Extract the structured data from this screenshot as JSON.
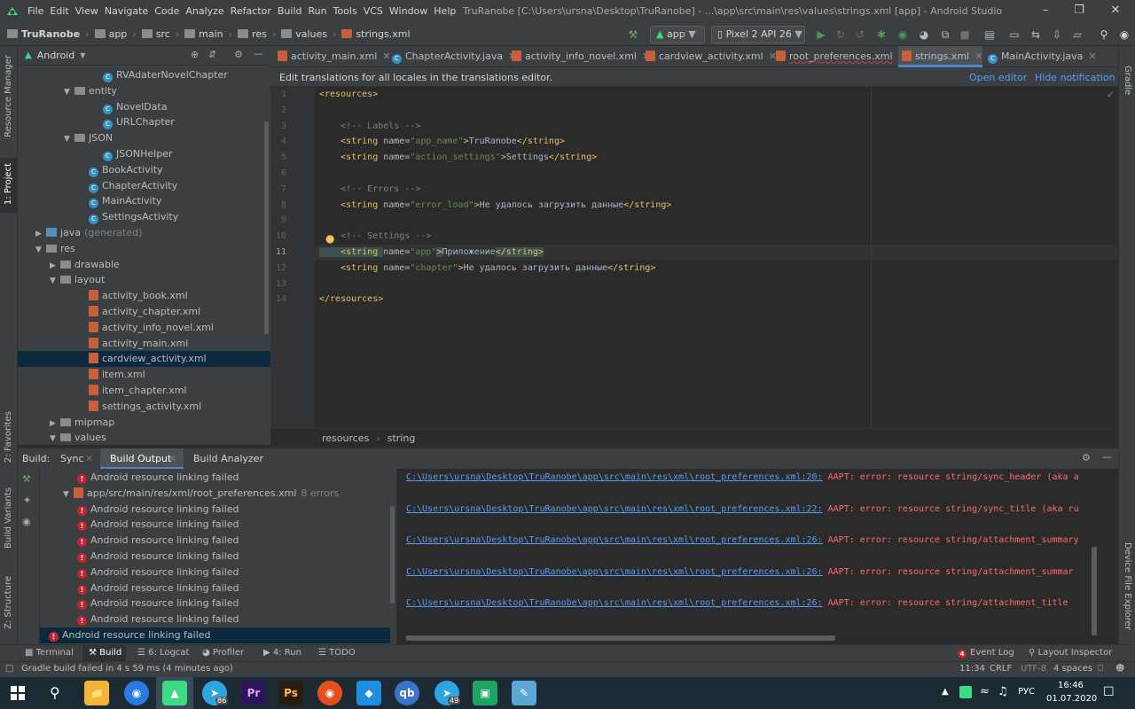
{
  "window": {
    "menu": [
      "File",
      "Edit",
      "View",
      "Navigate",
      "Code",
      "Analyze",
      "Refactor",
      "Build",
      "Run",
      "Tools",
      "VCS",
      "Window",
      "Help"
    ],
    "title": "TruRanobe [C:\\Users\\ursna\\Desktop\\TruRanobe] - ...\\app\\src\\main\\res\\values\\strings.xml [app] - Android Studio"
  },
  "breadcrumb": [
    "TruRanobe",
    "app",
    "src",
    "main",
    "res",
    "values",
    "strings.xml"
  ],
  "toolbar": {
    "config": "app",
    "device": "Pixel 2 API 26"
  },
  "left_strip": {
    "resource_manager": "Resource Manager",
    "project": "1: Project",
    "favorites": "2: Favorites",
    "build_variants": "Build Variants",
    "structure": "Z: Structure"
  },
  "right_strip": {
    "gradle": "Gradle",
    "device_file_explorer": "Device File Explorer"
  },
  "project": {
    "view_mode": "Android",
    "tree": [
      {
        "label": "RVAdaterNovelChapter",
        "icon": "class",
        "indent": 5
      },
      {
        "label": "entity",
        "icon": "folder",
        "indent": 3,
        "arrow": "▼"
      },
      {
        "label": "NovelData",
        "icon": "class",
        "indent": 5
      },
      {
        "label": "URLChapter",
        "icon": "class",
        "indent": 5
      },
      {
        "label": "JSON",
        "icon": "folder",
        "indent": 3,
        "arrow": "▼"
      },
      {
        "label": "JSONHelper",
        "icon": "class",
        "indent": 5
      },
      {
        "label": "BookActivity",
        "icon": "class",
        "indent": 4
      },
      {
        "label": "ChapterActivity",
        "icon": "class",
        "indent": 4
      },
      {
        "label": "MainActivity",
        "icon": "class",
        "indent": 4
      },
      {
        "label": "SettingsActivity",
        "icon": "class",
        "indent": 4
      },
      {
        "label": "java",
        "suffix": "(generated)",
        "icon": "java",
        "indent": 1,
        "arrow": "▶"
      },
      {
        "label": "res",
        "icon": "folder",
        "indent": 1,
        "arrow": "▼"
      },
      {
        "label": "drawable",
        "icon": "folder",
        "indent": 2,
        "arrow": "▶"
      },
      {
        "label": "layout",
        "icon": "folder",
        "indent": 2,
        "arrow": "▼"
      },
      {
        "label": "activity_book.xml",
        "icon": "xml",
        "indent": 4
      },
      {
        "label": "activity_chapter.xml",
        "icon": "xml",
        "indent": 4
      },
      {
        "label": "activity_info_novel.xml",
        "icon": "xml",
        "indent": 4
      },
      {
        "label": "activity_main.xml",
        "icon": "xml",
        "indent": 4
      },
      {
        "label": "cardview_activity.xml",
        "icon": "xml",
        "indent": 4,
        "selected": true
      },
      {
        "label": "item.xml",
        "icon": "xml",
        "indent": 4
      },
      {
        "label": "item_chapter.xml",
        "icon": "xml",
        "indent": 4
      },
      {
        "label": "settings_activity.xml",
        "icon": "xml",
        "indent": 4
      },
      {
        "label": "mipmap",
        "icon": "folder",
        "indent": 2,
        "arrow": "▶"
      },
      {
        "label": "values",
        "icon": "folder",
        "indent": 2,
        "arrow": "▼"
      }
    ]
  },
  "tabs": [
    {
      "label": "activity_main.xml",
      "icon": "xml"
    },
    {
      "label": "ChapterActivity.java",
      "icon": "class"
    },
    {
      "label": "activity_info_novel.xml",
      "icon": "xml"
    },
    {
      "label": "cardview_activity.xml",
      "icon": "xml"
    },
    {
      "label": "root_preferences.xml",
      "icon": "xml"
    },
    {
      "label": "strings.xml",
      "icon": "xml",
      "active": true
    },
    {
      "label": "MainActivity.java",
      "icon": "class"
    }
  ],
  "notice": {
    "text": "Edit translations for all locales in the translations editor.",
    "open_editor": "Open editor",
    "hide": "Hide notification"
  },
  "editor": {
    "line_numbers": [
      "1",
      "2",
      "3",
      "4",
      "5",
      "6",
      "7",
      "8",
      "9",
      "10",
      "11",
      "12",
      "13",
      "14"
    ],
    "lines": [
      [
        {
          "t": "<resources>",
          "c": "tg"
        }
      ],
      [],
      [
        {
          "t": "    <!-- Labels -->",
          "c": "cm"
        }
      ],
      [
        {
          "t": "    <string ",
          "c": "tg"
        },
        {
          "t": "name=",
          "c": "at"
        },
        {
          "t": "\"app_name\"",
          "c": "av"
        },
        {
          "t": ">",
          "c": "tg"
        },
        {
          "t": "TruRanobe",
          "c": "tx"
        },
        {
          "t": "</string>",
          "c": "tg"
        }
      ],
      [
        {
          "t": "    <string ",
          "c": "tg"
        },
        {
          "t": "name=",
          "c": "at"
        },
        {
          "t": "\"action_settings\"",
          "c": "av"
        },
        {
          "t": ">",
          "c": "tg"
        },
        {
          "t": "Settings",
          "c": "tx"
        },
        {
          "t": "</string>",
          "c": "tg"
        }
      ],
      [],
      [
        {
          "t": "    <!-- Errors -->",
          "c": "cm"
        }
      ],
      [
        {
          "t": "    <string ",
          "c": "tg"
        },
        {
          "t": "name=",
          "c": "at"
        },
        {
          "t": "\"error_load\"",
          "c": "av"
        },
        {
          "t": ">",
          "c": "tg"
        },
        {
          "t": "Не удалось загрузить данные",
          "c": "tx"
        },
        {
          "t": "</string>",
          "c": "tg"
        }
      ],
      [],
      [
        {
          "t": "    <!-- Settings -->",
          "c": "cm"
        }
      ],
      [
        {
          "t": "    <string ",
          "c": "tg"
        },
        {
          "t": "name=",
          "c": "at"
        },
        {
          "t": "\"app\"",
          "c": "av"
        },
        {
          "t": ">",
          "c": "tg"
        },
        {
          "t": "Приложение",
          "c": "tx"
        },
        {
          "t": "</string>",
          "c": "tg"
        }
      ],
      [
        {
          "t": "    <string ",
          "c": "tg"
        },
        {
          "t": "name=",
          "c": "at"
        },
        {
          "t": "\"chapter\"",
          "c": "av"
        },
        {
          "t": ">",
          "c": "tg"
        },
        {
          "t": "Не удалось загрузить данные",
          "c": "tx"
        },
        {
          "t": "</string>",
          "c": "tg"
        }
      ],
      [],
      [
        {
          "t": "</resources>",
          "c": "tg"
        }
      ]
    ],
    "crumb": [
      "resources",
      "string"
    ]
  },
  "build": {
    "tabs": [
      "Build:",
      "Sync",
      "Build Output",
      "Build Analyzer"
    ],
    "tree": [
      {
        "label": "Android resource linking failed",
        "type": "error",
        "indent": 2
      },
      {
        "label": "app/src/main/res/xml/root_preferences.xml",
        "suffix": "8 errors",
        "type": "file",
        "indent": 1
      },
      {
        "label": "Android resource linking failed",
        "type": "error",
        "indent": 2
      },
      {
        "label": "Android resource linking failed",
        "type": "error",
        "indent": 2
      },
      {
        "label": "Android resource linking failed",
        "type": "error",
        "indent": 2
      },
      {
        "label": "Android resource linking failed",
        "type": "error",
        "indent": 2
      },
      {
        "label": "Android resource linking failed",
        "type": "error",
        "indent": 2
      },
      {
        "label": "Android resource linking failed",
        "type": "error",
        "indent": 2
      },
      {
        "label": "Android resource linking failed",
        "type": "error",
        "indent": 2
      },
      {
        "label": "Android resource linking failed",
        "type": "error",
        "indent": 2
      },
      {
        "label": "Android resource linking failed",
        "type": "error",
        "indent": 0,
        "selected": true
      }
    ],
    "output": [
      {
        "link": "C:\\Users\\ursna\\Desktop\\TruRanobe\\app\\src\\main\\res\\xml\\root_preferences.xml:20:",
        "msg": " AAPT: error: resource string/sync_header (aka a"
      },
      {
        "link": "C:\\Users\\ursna\\Desktop\\TruRanobe\\app\\src\\main\\res\\xml\\root_preferences.xml:22:",
        "msg": " AAPT: error: resource string/sync_title (aka ru"
      },
      {
        "link": "C:\\Users\\ursna\\Desktop\\TruRanobe\\app\\src\\main\\res\\xml\\root_preferences.xml:26:",
        "msg": " AAPT: error: resource string/attachment_summary"
      },
      {
        "link": "C:\\Users\\ursna\\Desktop\\TruRanobe\\app\\src\\main\\res\\xml\\root_preferences.xml:26:",
        "msg": " AAPT: error: resource string/attachment_summar"
      },
      {
        "link": "C:\\Users\\ursna\\Desktop\\TruRanobe\\app\\src\\main\\res\\xml\\root_preferences.xml:26:",
        "msg": " AAPT: error: resource string/attachment_title"
      }
    ]
  },
  "toolwindows": {
    "terminal": "Terminal",
    "build": "Build",
    "logcat": "6: Logcat",
    "profiler": "Profiler",
    "run": "4: Run",
    "todo": "TODO",
    "event_log": "Event Log",
    "layout_inspector": "Layout Inspector"
  },
  "status": {
    "message": "Gradle build failed in 4 s 59 ms (4 minutes ago)",
    "position": "11:34",
    "line_sep": "CRLF",
    "encoding": "UTF-8",
    "indent": "4 spaces",
    "event_count": "4"
  },
  "taskbar": {
    "lang": "РУС",
    "time": "16:46",
    "date": "01.07.2020",
    "badge_1": "86",
    "badge_2": "49"
  }
}
